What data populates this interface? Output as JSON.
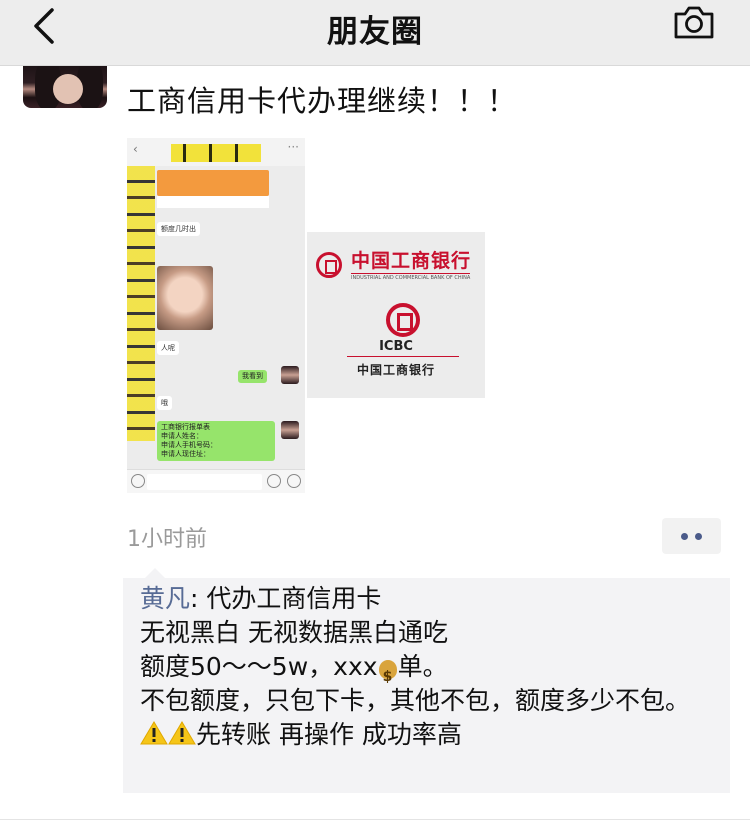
{
  "navbar": {
    "title": "朋友圈",
    "back_icon": "chevron-left-icon",
    "camera_icon": "camera-icon"
  },
  "post": {
    "text": "工商信用卡代办理继续！！！",
    "images": {
      "chat_screenshot": {
        "bubbles": [
          "额度几时出",
          "人呢",
          "哦"
        ],
        "reply_short": "我看到",
        "form_lines": [
          "工商银行报单表",
          "申请人姓名：",
          "申请人手机号码：",
          "申请人现住址："
        ]
      },
      "icbc_logo": {
        "name_cn": "中国工商银行",
        "name_en": "INDUSTRIAL AND COMMERCIAL BANK OF CHINA",
        "abbr": "ICBC",
        "brand_color": "#c8102e"
      }
    },
    "time": "1小时前",
    "more_icon": "more-dots-icon"
  },
  "comments": [
    {
      "author": "黄凡",
      "separator": ": ",
      "line1": "代办工商信用卡",
      "line2": "无视黑白  无视数据黑白通吃",
      "line3_pre": "额度50～～5w，xxx",
      "line3_icon": "money-bag-icon",
      "line3_post": "单。",
      "line4": "不包额度，只包下卡，其他不包，额度多少不包。",
      "line5_icons": [
        "warning-icon",
        "warning-icon"
      ],
      "line5": "先转账  再操作  成功率高"
    }
  ],
  "colors": {
    "nav_bg": "#ededed",
    "link": "#576b95",
    "comment_bg": "#f3f3f5",
    "time": "#9a9a9a"
  }
}
